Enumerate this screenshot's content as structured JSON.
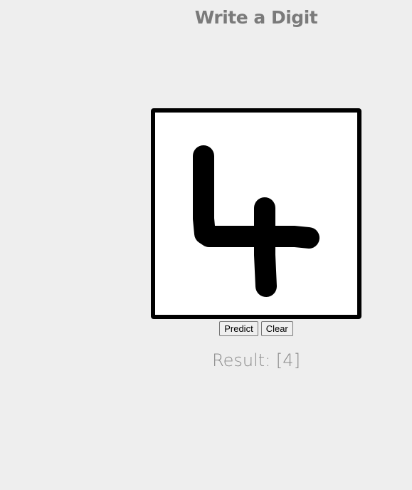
{
  "header": {
    "title": "Write a Digit"
  },
  "canvas": {
    "stroke_color": "#000000",
    "background_color": "#ffffff",
    "drawn_digit": "4"
  },
  "controls": {
    "predict_label": "Predict",
    "clear_label": "Clear"
  },
  "result": {
    "text": "Result: [4]"
  }
}
